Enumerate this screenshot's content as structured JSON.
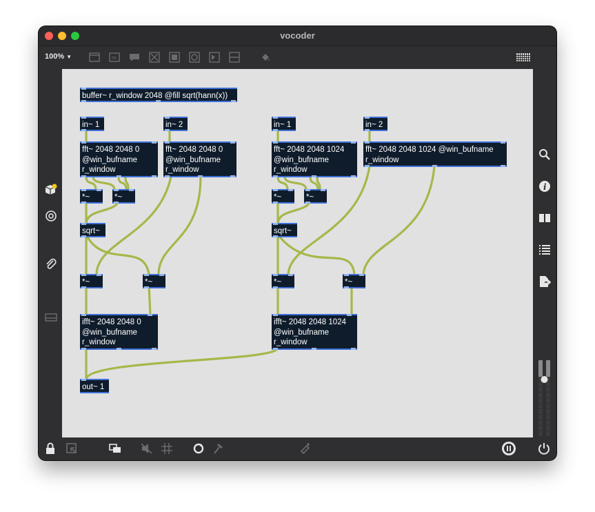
{
  "window": {
    "title": "vocoder"
  },
  "toolbar": {
    "zoom": "100%",
    "icons": [
      "presentation-icon",
      "comment-icon",
      "message-icon",
      "toggle-icon",
      "button-icon",
      "bang-icon",
      "number-icon",
      "slider-icon",
      "paint-bucket-icon",
      "grid-keyboard-icon"
    ]
  },
  "patch": {
    "buffer": "buffer~ r_window 2048 @fill sqrt(hann(x))",
    "left": {
      "in1": "in~ 1",
      "in2": "in~ 2",
      "fft1": [
        "fft~ 2048 2048 0",
        "@win_bufname",
        "r_window"
      ],
      "fft2": [
        "fft~ 2048 2048 0",
        "@win_bufname",
        "r_window"
      ],
      "mul1": "*~",
      "mul2": "*~",
      "sqrt": "sqrt~",
      "mul3": "*~",
      "mul4": "*~",
      "ifft": [
        "ifft~ 2048 2048 0",
        "@win_bufname",
        "r_window"
      ],
      "out": "out~ 1"
    },
    "right": {
      "in1": "in~ 1",
      "in2": "in~ 2",
      "fft1": [
        "fft~ 2048 2048 1024",
        "@win_bufname",
        "r_window"
      ],
      "fft2": [
        "fft~ 2048 2048 1024 @win_bufname",
        "r_window"
      ],
      "mul1": "*~",
      "mul2": "*~",
      "sqrt": "sqrt~",
      "mul3": "*~",
      "mul4": "*~",
      "ifft": [
        "ifft~ 2048 2048 1024",
        "@win_bufname",
        "r_window"
      ]
    }
  },
  "colors": {
    "canvas": "#e1e1e1",
    "object_bg": "#0f1c2b",
    "object_border": "#3d6fd6",
    "cord": "#a5b84a",
    "cord_dash": "#2b2b1a",
    "chrome": "#2f2f31"
  }
}
